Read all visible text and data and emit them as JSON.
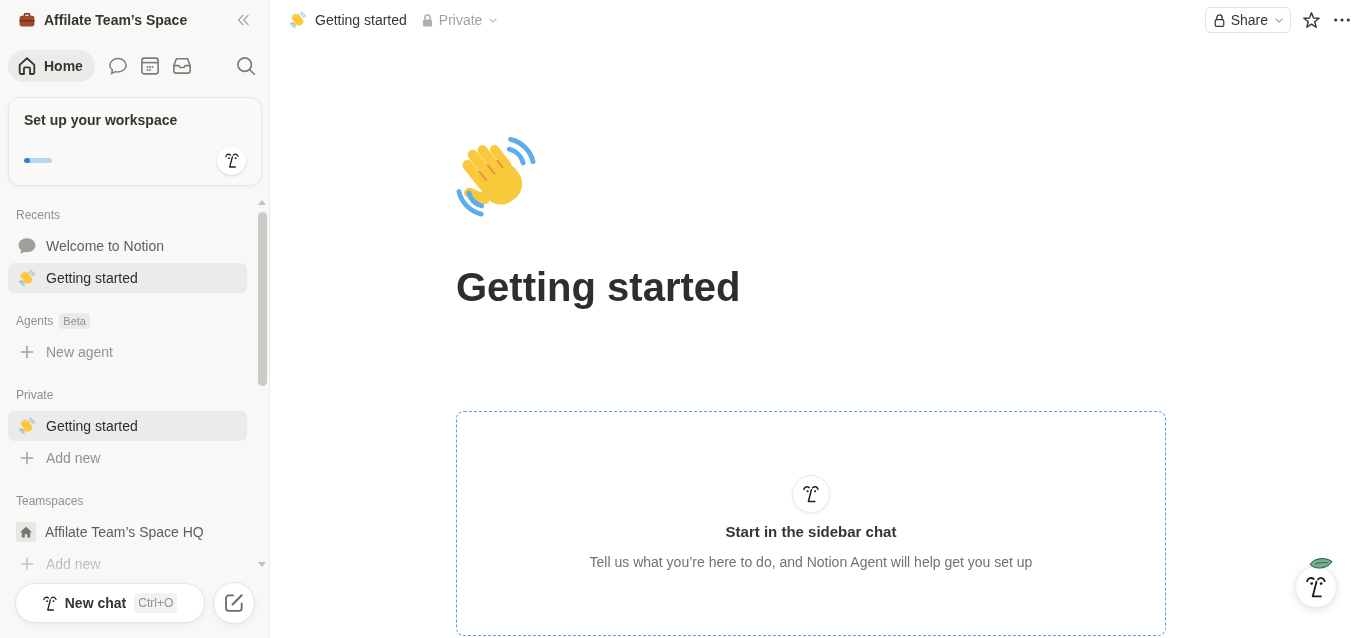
{
  "sidebar": {
    "workspace": "Affilate Team’s Space",
    "nav": [
      {
        "kind": "home",
        "label": "Home",
        "selected": true
      },
      {
        "kind": "chat",
        "selected": false
      },
      {
        "kind": "calendar",
        "selected": false
      },
      {
        "kind": "inbox",
        "selected": false
      }
    ],
    "setup_card": {
      "title": "Set up your workspace",
      "level": 0.2
    },
    "sections": [
      {
        "title": "Recents",
        "items": [
          {
            "kind": "chat",
            "label": "Welcome to Notion",
            "selected": false
          },
          {
            "kind": "wave",
            "label": "Getting started",
            "selected": true
          }
        ]
      },
      {
        "title": "Agents",
        "badge": "Beta",
        "items": [
          {
            "kind": "add",
            "label": "New agent",
            "selected": false
          }
        ]
      },
      {
        "title": "Private",
        "items": [
          {
            "kind": "wave",
            "label": "Getting started",
            "selected": true
          },
          {
            "kind": "add",
            "label": "Add new",
            "selected": false
          }
        ]
      },
      {
        "title": "Teamspaces",
        "items": [
          {
            "kind": "team",
            "label": "Affilate Team’s Space HQ",
            "selected": false
          },
          {
            "kind": "add",
            "label": "Add new",
            "selected": false
          }
        ]
      }
    ],
    "new_chat": {
      "label": "New chat",
      "shortcut": "Ctrl+O"
    }
  },
  "topbar": {
    "page": "Getting started",
    "privacy": "Private",
    "share": "Share"
  },
  "page": {
    "title": "Getting started",
    "prompt": {
      "title": "Start in the sidebar chat",
      "text": "Tell us what you’re here to do, and Notion Agent will help get you set up"
    }
  }
}
